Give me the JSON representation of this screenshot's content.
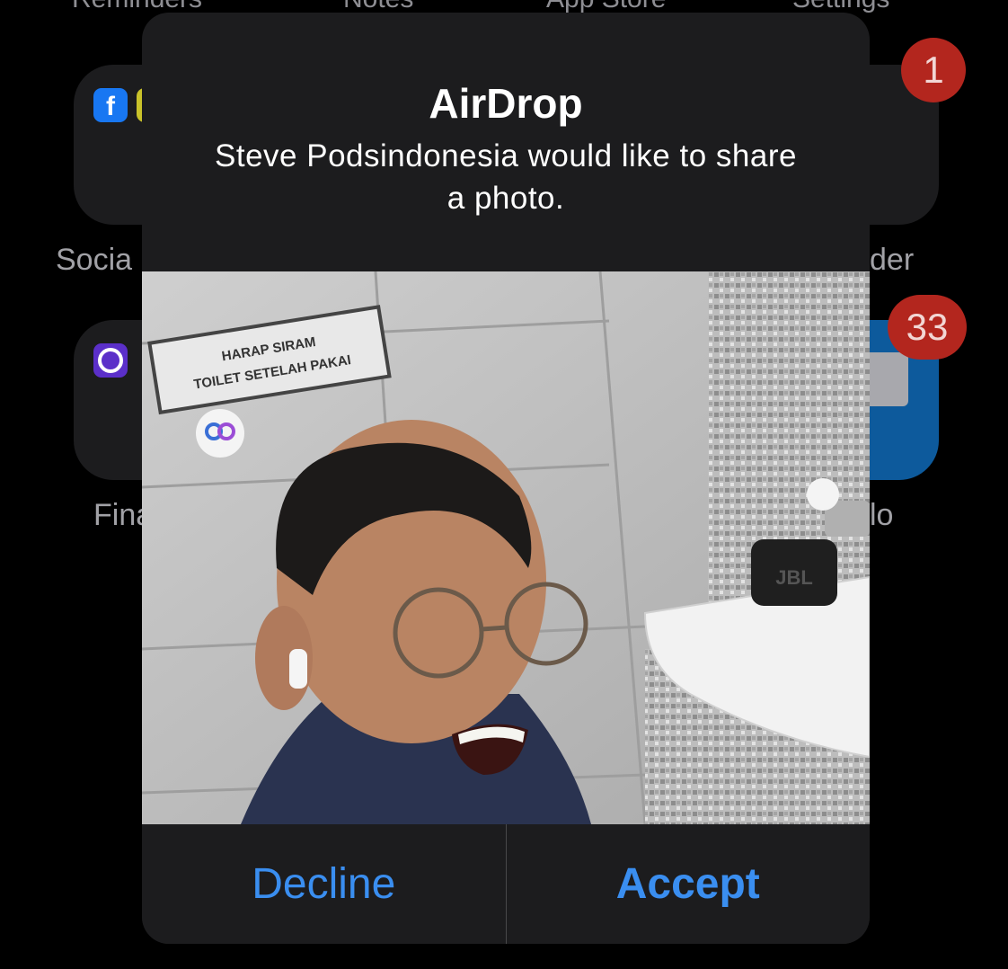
{
  "home": {
    "top_labels": [
      "Reminders",
      "Notes",
      "App Store",
      "Settings"
    ],
    "folder_labels": {
      "social": "Socia",
      "right_top": "der",
      "finance": "Fina",
      "right_bottom": "lo"
    },
    "badges": [
      "1",
      "33"
    ]
  },
  "alert": {
    "title": "AirDrop",
    "message": "Steve Podsindonesia would like to share a photo.",
    "photo": {
      "sign_line1": "HARAP SIRAM",
      "sign_line2": "TOILET SETELAH PAKAI",
      "speaker_brand": "JBL"
    },
    "decline_label": "Decline",
    "accept_label": "Accept"
  },
  "colors": {
    "accent": "#3a8ef0",
    "alert_bg": "#1c1c1e",
    "badge": "#b3261e"
  }
}
